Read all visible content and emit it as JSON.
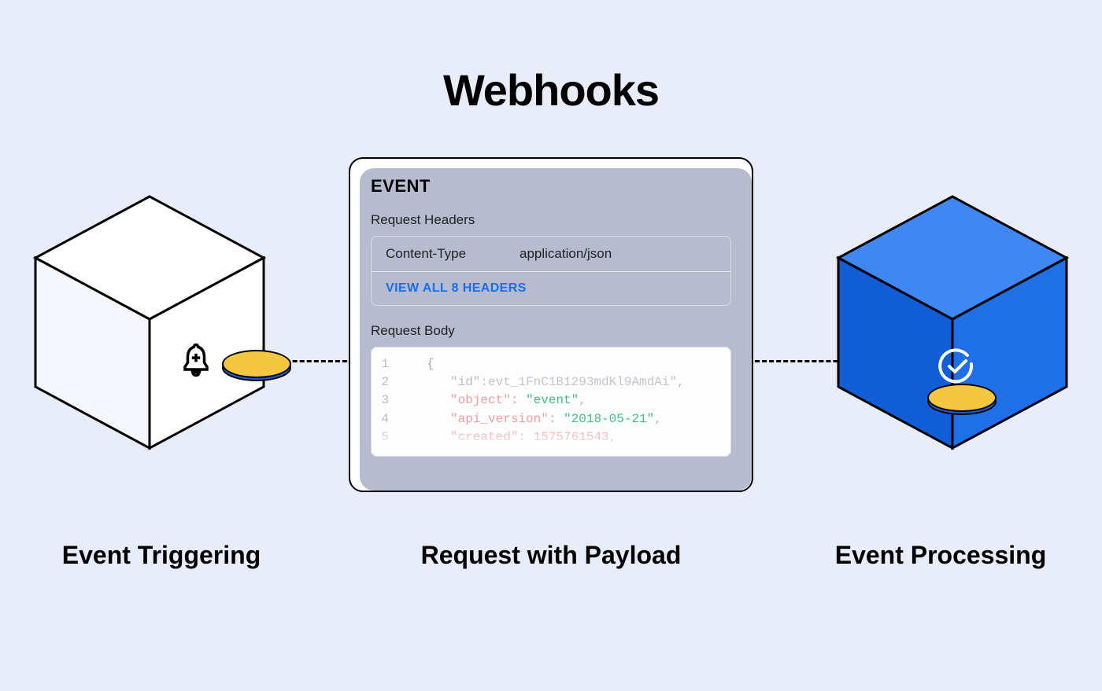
{
  "title": "Webhooks",
  "labels": {
    "left": "Event Triggering",
    "center": "Request with Payload",
    "right": "Event Processing"
  },
  "card": {
    "heading": "EVENT",
    "headers_label": "Request Headers",
    "header_key": "Content-Type",
    "header_value": "application/json",
    "view_all": "VIEW ALL 8 HEADERS",
    "body_label": "Request Body",
    "code": {
      "ln1": "1",
      "ln2": "2",
      "ln3": "3",
      "ln4": "4",
      "ln5": "5",
      "brace_open": "{",
      "line2_key": "\"id\"",
      "line2_val": ":evt_1FnC1B1293mdKl9AmdAi\"",
      "line3_key": "\"object\":",
      "line3_val": "\"event\"",
      "line4_key": "\"api_version\":",
      "line4_val": "\"2018-05-21\"",
      "line5_key": "\"created\":",
      "line5_val": "1575761543",
      "comma": ","
    }
  },
  "icons": {
    "bell": "bell-add-icon",
    "check": "check-circle-icon",
    "coin": "coin-icon"
  }
}
